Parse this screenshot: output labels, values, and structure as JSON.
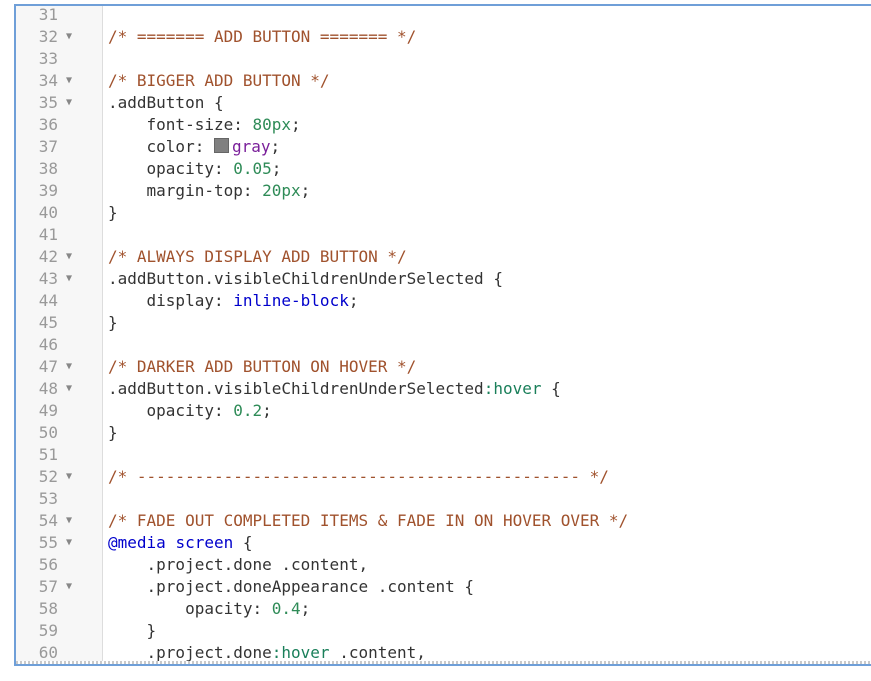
{
  "lines": [
    {
      "n": "31",
      "fold": "",
      "tokens": []
    },
    {
      "n": "32",
      "fold": "▼",
      "tokens": [
        {
          "t": "/* ======= ADD BUTTON ======= */",
          "c": "comment"
        }
      ]
    },
    {
      "n": "33",
      "fold": "",
      "tokens": []
    },
    {
      "n": "34",
      "fold": "▼",
      "tokens": [
        {
          "t": "/* BIGGER ADD BUTTON */",
          "c": "comment"
        }
      ]
    },
    {
      "n": "35",
      "fold": "▼",
      "tokens": [
        {
          "t": ".addButton {",
          "c": ""
        }
      ]
    },
    {
      "n": "36",
      "fold": "",
      "tokens": [
        {
          "t": "    font-size: ",
          "c": ""
        },
        {
          "t": "80px",
          "c": "number"
        },
        {
          "t": ";",
          "c": ""
        }
      ]
    },
    {
      "n": "37",
      "fold": "",
      "tokens": [
        {
          "t": "    color: ",
          "c": ""
        },
        {
          "t": "",
          "c": "swatch"
        },
        {
          "t": "gray",
          "c": "string"
        },
        {
          "t": ";",
          "c": ""
        }
      ]
    },
    {
      "n": "38",
      "fold": "",
      "tokens": [
        {
          "t": "    opacity: ",
          "c": ""
        },
        {
          "t": "0.05",
          "c": "number"
        },
        {
          "t": ";",
          "c": ""
        }
      ]
    },
    {
      "n": "39",
      "fold": "",
      "tokens": [
        {
          "t": "    margin-top: ",
          "c": ""
        },
        {
          "t": "20px",
          "c": "number"
        },
        {
          "t": ";",
          "c": ""
        }
      ]
    },
    {
      "n": "40",
      "fold": "",
      "tokens": [
        {
          "t": "}",
          "c": ""
        }
      ]
    },
    {
      "n": "41",
      "fold": "",
      "tokens": []
    },
    {
      "n": "42",
      "fold": "▼",
      "tokens": [
        {
          "t": "/* ALWAYS DISPLAY ADD BUTTON */",
          "c": "comment"
        }
      ]
    },
    {
      "n": "43",
      "fold": "▼",
      "tokens": [
        {
          "t": ".addButton.visibleChildrenUnderSelected {",
          "c": ""
        }
      ]
    },
    {
      "n": "44",
      "fold": "",
      "tokens": [
        {
          "t": "    display: ",
          "c": ""
        },
        {
          "t": "inline-block",
          "c": "keyword"
        },
        {
          "t": ";",
          "c": ""
        }
      ]
    },
    {
      "n": "45",
      "fold": "",
      "tokens": [
        {
          "t": "}",
          "c": ""
        }
      ]
    },
    {
      "n": "46",
      "fold": "",
      "tokens": []
    },
    {
      "n": "47",
      "fold": "▼",
      "tokens": [
        {
          "t": "/* DARKER ADD BUTTON ON HOVER */",
          "c": "comment"
        }
      ]
    },
    {
      "n": "48",
      "fold": "▼",
      "tokens": [
        {
          "t": ".addButton.visibleChildrenUnderSelected",
          "c": ""
        },
        {
          "t": ":hover",
          "c": "pseudo"
        },
        {
          "t": " {",
          "c": ""
        }
      ]
    },
    {
      "n": "49",
      "fold": "",
      "tokens": [
        {
          "t": "    opacity: ",
          "c": ""
        },
        {
          "t": "0.2",
          "c": "number"
        },
        {
          "t": ";",
          "c": ""
        }
      ]
    },
    {
      "n": "50",
      "fold": "",
      "tokens": [
        {
          "t": "}",
          "c": ""
        }
      ]
    },
    {
      "n": "51",
      "fold": "",
      "tokens": []
    },
    {
      "n": "52",
      "fold": "▼",
      "tokens": [
        {
          "t": "/* ---------------------------------------------- */",
          "c": "comment"
        }
      ]
    },
    {
      "n": "53",
      "fold": "",
      "tokens": []
    },
    {
      "n": "54",
      "fold": "▼",
      "tokens": [
        {
          "t": "/* FADE OUT COMPLETED ITEMS & FADE IN ON HOVER OVER */",
          "c": "comment"
        }
      ]
    },
    {
      "n": "55",
      "fold": "▼",
      "tokens": [
        {
          "t": "@media",
          "c": "keyword"
        },
        {
          "t": " ",
          "c": ""
        },
        {
          "t": "screen",
          "c": "keyword"
        },
        {
          "t": " {",
          "c": ""
        }
      ]
    },
    {
      "n": "56",
      "fold": "",
      "tokens": [
        {
          "t": "    .project.done .content,",
          "c": ""
        }
      ]
    },
    {
      "n": "57",
      "fold": "▼",
      "tokens": [
        {
          "t": "    .project.doneAppearance .content {",
          "c": ""
        }
      ]
    },
    {
      "n": "58",
      "fold": "",
      "tokens": [
        {
          "t": "        opacity: ",
          "c": ""
        },
        {
          "t": "0.4",
          "c": "number"
        },
        {
          "t": ";",
          "c": ""
        }
      ]
    },
    {
      "n": "59",
      "fold": "",
      "tokens": [
        {
          "t": "    }",
          "c": ""
        }
      ]
    },
    {
      "n": "60",
      "fold": "",
      "tokens": [
        {
          "t": "    .project.done",
          "c": ""
        },
        {
          "t": ":hover",
          "c": "pseudo"
        },
        {
          "t": " .content,",
          "c": ""
        }
      ]
    }
  ]
}
